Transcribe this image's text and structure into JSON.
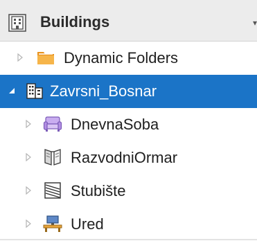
{
  "panel": {
    "title": "Buildings",
    "dropdown_glyph": "▾"
  },
  "tree": {
    "items": [
      {
        "label": "Dynamic Folders",
        "icon": "folder-icon",
        "expanded": false
      },
      {
        "label": "Zavrsni_Bosnar",
        "icon": "building-icon",
        "expanded": true,
        "selected": true
      },
      {
        "label": "DnevnaSoba",
        "icon": "armchair-icon",
        "expanded": false
      },
      {
        "label": "RazvodniOrmar",
        "icon": "cabinet-icon",
        "expanded": false
      },
      {
        "label": "Stubište",
        "icon": "stairs-icon",
        "expanded": false
      },
      {
        "label": "Ured",
        "icon": "desk-icon",
        "expanded": false
      }
    ]
  },
  "colors": {
    "selection": "#1b74c7",
    "folder": "#f0a22e",
    "armchair": "#b38fe3"
  }
}
